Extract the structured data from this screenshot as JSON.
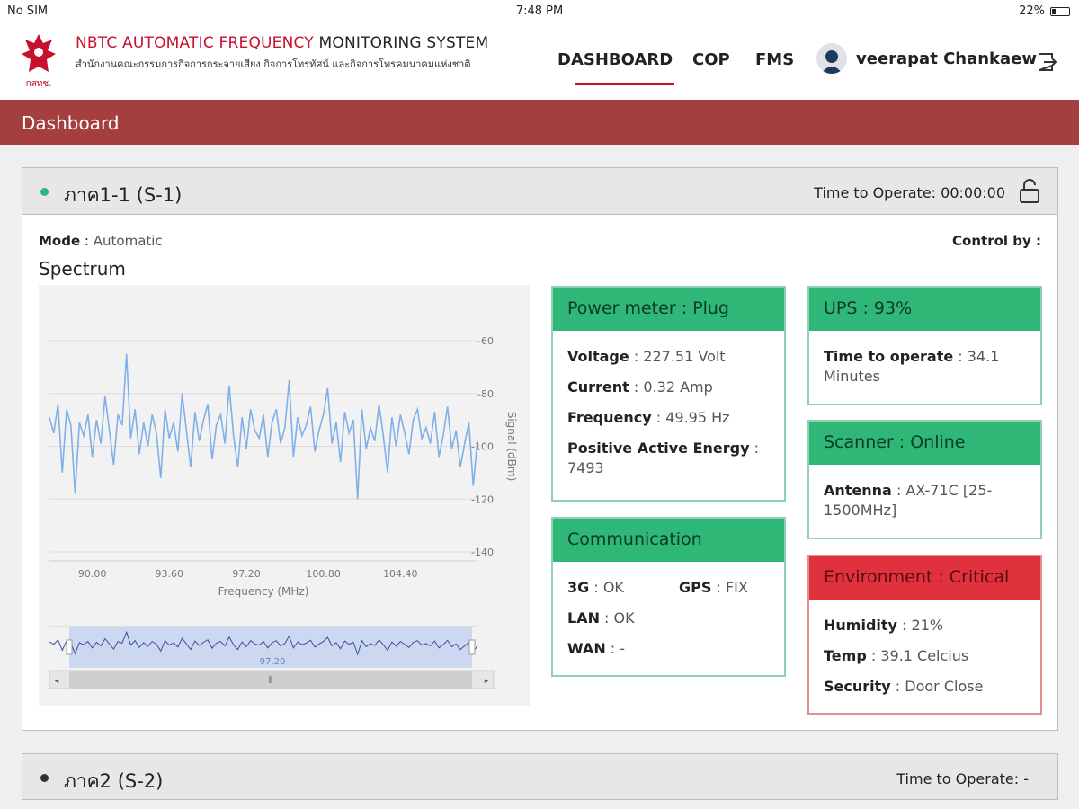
{
  "status": {
    "carrier": "No SIM",
    "time": "7:48 PM",
    "battery": "22%"
  },
  "brand": {
    "title_red": "NBTC AUTOMATIC FREQUENCY",
    "title_rest": "MONITORING SYSTEM",
    "subtitle": "สำนักงานคณะกรรมการกิจการกระจายเสียง กิจการโทรทัศน์ และกิจการโทรคมนาคมแห่งชาติ",
    "logo_text": "กสทช."
  },
  "nav": {
    "dashboard": "DASHBOARD",
    "cop": "COP",
    "fms": "FMS",
    "user": "veerapat Chankaew"
  },
  "page_title": "Dashboard",
  "station1": {
    "title": "ภาค1-1 (S-1)",
    "time_label": "Time to Operate: 00:00:00",
    "status_color": "#2fb778",
    "mode_label": "Mode",
    "mode_value": "Automatic",
    "control_label": "Control by :",
    "spectrum_title": "Spectrum"
  },
  "power": {
    "header": "Power meter : Plug",
    "voltage_label": "Voltage",
    "voltage_value": "227.51 Volt",
    "current_label": "Current",
    "current_value": "0.32 Amp",
    "freq_label": "Frequency",
    "freq_value": "49.95 Hz",
    "energy_label": "Positive Active Energy",
    "energy_value": "7493"
  },
  "ups": {
    "header": "UPS : 93%",
    "time_label": "Time to operate",
    "time_value": "34.1 Minutes"
  },
  "scanner": {
    "header": "Scanner : Online",
    "antenna_label": "Antenna",
    "antenna_value": "AX-71C [25-1500MHz]"
  },
  "comm": {
    "header": "Communication",
    "g3_label": "3G",
    "g3_value": "OK",
    "gps_label": "GPS",
    "gps_value": "FIX",
    "lan_label": "LAN",
    "lan_value": "OK",
    "wan_label": "WAN",
    "wan_value": "-"
  },
  "env": {
    "header": "Environment : Critical",
    "humidity_label": "Humidity",
    "humidity_value": "21%",
    "temp_label": "Temp",
    "temp_value": "39.1 Celcius",
    "security_label": "Security",
    "security_value": "Door Close"
  },
  "station2": {
    "title": "ภาค2 (S-2)",
    "time_label": "Time to Operate: -",
    "status_color": "#333333"
  },
  "chart_data": {
    "type": "line",
    "xlabel": "Frequency (MHz)",
    "ylabel": "Signal (dBm)",
    "x_ticks": [
      "90.00",
      "93.60",
      "97.20",
      "100.80",
      "104.40"
    ],
    "y_ticks": [
      "-60",
      "-80",
      "-100",
      "-120",
      "-140"
    ],
    "ylim": [
      -140,
      -60
    ],
    "xlim": [
      88.0,
      108.0
    ],
    "navigator_label": "97.20",
    "series": [
      {
        "color": "#7fb0e8",
        "x": [
          88.0,
          88.2,
          88.4,
          88.6,
          88.8,
          89.0,
          89.2,
          89.4,
          89.6,
          89.8,
          90.0,
          90.2,
          90.4,
          90.6,
          90.8,
          91.0,
          91.2,
          91.4,
          91.6,
          91.8,
          92.0,
          92.2,
          92.4,
          92.6,
          92.8,
          93.0,
          93.2,
          93.4,
          93.6,
          93.8,
          94.0,
          94.2,
          94.4,
          94.6,
          94.8,
          95.0,
          95.2,
          95.4,
          95.6,
          95.8,
          96.0,
          96.2,
          96.4,
          96.6,
          96.8,
          97.0,
          97.2,
          97.4,
          97.6,
          97.8,
          98.0,
          98.2,
          98.4,
          98.6,
          98.8,
          99.0,
          99.2,
          99.4,
          99.6,
          99.8,
          100.0,
          100.2,
          100.4,
          100.6,
          100.8,
          101.0,
          101.2,
          101.4,
          101.6,
          101.8,
          102.0,
          102.2,
          102.4,
          102.6,
          102.8,
          103.0,
          103.2,
          103.4,
          103.6,
          103.8,
          104.0,
          104.2,
          104.4,
          104.6,
          104.8,
          105.0,
          105.2,
          105.4,
          105.6,
          105.8,
          106.0,
          106.2,
          106.4,
          106.6,
          106.8,
          107.0,
          107.2,
          107.4,
          107.6,
          107.8,
          108.0
        ],
        "y": [
          -89,
          -95,
          -84,
          -110,
          -86,
          -92,
          -118,
          -91,
          -96,
          -88,
          -104,
          -90,
          -99,
          -81,
          -94,
          -107,
          -88,
          -92,
          -65,
          -97,
          -86,
          -103,
          -91,
          -100,
          -88,
          -95,
          -112,
          -86,
          -97,
          -91,
          -102,
          -80,
          -94,
          -108,
          -87,
          -98,
          -90,
          -84,
          -105,
          -92,
          -88,
          -99,
          -77,
          -96,
          -108,
          -89,
          -101,
          -86,
          -94,
          -97,
          -88,
          -104,
          -91,
          -86,
          -99,
          -93,
          -75,
          -104,
          -89,
          -96,
          -92,
          -85,
          -102,
          -94,
          -88,
          -78,
          -99,
          -91,
          -106,
          -87,
          -95,
          -90,
          -120,
          -86,
          -101,
          -93,
          -98,
          -84,
          -96,
          -110,
          -89,
          -100,
          -88,
          -95,
          -103,
          -90,
          -86,
          -97,
          -93,
          -99,
          -87,
          -104,
          -96,
          -85,
          -101,
          -94,
          -108,
          -99,
          -91,
          -115,
          -98
        ]
      }
    ]
  }
}
